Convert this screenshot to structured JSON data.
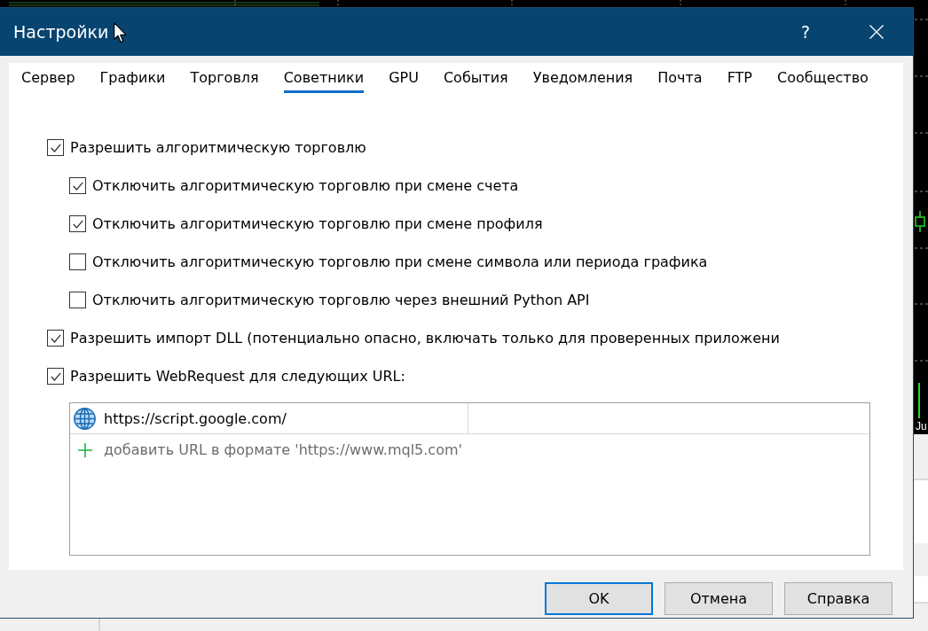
{
  "window": {
    "title": "Настройки",
    "help_button": "?"
  },
  "tabs": [
    {
      "label": "Сервер",
      "selected": false
    },
    {
      "label": "Графики",
      "selected": false
    },
    {
      "label": "Торговля",
      "selected": false
    },
    {
      "label": "Советники",
      "selected": true
    },
    {
      "label": "GPU",
      "selected": false
    },
    {
      "label": "События",
      "selected": false
    },
    {
      "label": "Уведомления",
      "selected": false
    },
    {
      "label": "Почта",
      "selected": false
    },
    {
      "label": "FTP",
      "selected": false
    },
    {
      "label": "Сообщество",
      "selected": false
    }
  ],
  "options": [
    {
      "label": "Разрешить алгоритмическую торговлю",
      "checked": true,
      "children": [
        {
          "label": "Отключить алгоритмическую торговлю при смене счета",
          "checked": true
        },
        {
          "label": "Отключить алгоритмическую торговлю при смене профиля",
          "checked": true
        },
        {
          "label": "Отключить алгоритмическую торговлю при смене символа или периода графика",
          "checked": false
        },
        {
          "label": "Отключить алгоритмическую торговлю через внешний Python API",
          "checked": false
        }
      ]
    },
    {
      "label": "Разрешить импорт DLL (потенциально опасно, включать только для проверенных приложени",
      "checked": true
    },
    {
      "label": "Разрешить WebRequest для следующих URL:",
      "checked": true
    }
  ],
  "url_list": {
    "rows": [
      {
        "url": "https://script.google.com/"
      }
    ],
    "placeholder": "добавить URL в формате 'https://www.mql5.com'"
  },
  "buttons": [
    {
      "label": "OK",
      "default": true
    },
    {
      "label": "Отмена",
      "default": false
    },
    {
      "label": "Справка",
      "default": false
    }
  ],
  "background": {
    "axis_label": "Ju"
  }
}
